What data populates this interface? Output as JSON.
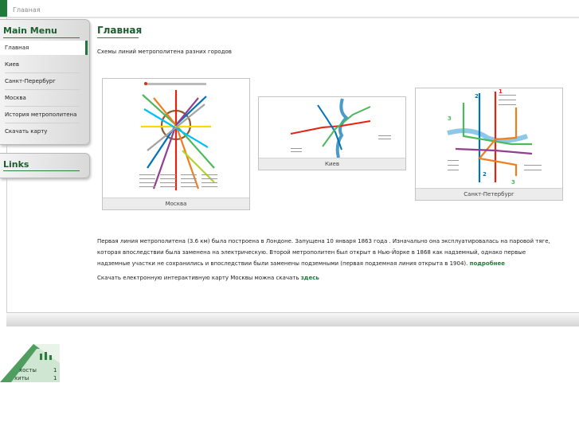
{
  "breadcrumb": "Главная",
  "sidebar": {
    "main_menu_title": "Main Menu",
    "items": [
      {
        "label": "Главная"
      },
      {
        "label": "Киев"
      },
      {
        "label": "Санкт-Перербург"
      },
      {
        "label": "Москва"
      },
      {
        "label": "История метрополитена"
      },
      {
        "label": "Скачать карту"
      }
    ],
    "links_title": "Links"
  },
  "main": {
    "title": "Главная",
    "subtitle": "Схемы линий метрополитена разних городов",
    "maps": [
      {
        "caption": "Москва"
      },
      {
        "caption": "Киев"
      },
      {
        "caption": "Санкт-Петербург"
      }
    ],
    "paragraph1_text": "Первая линия метрополитена  (3.6 км) была построена в Лондоне. Запущена 10 января 1863 года  . Изначально она эксплуатировалась на паровой тяге, которая впоследствии была заменена на электрическую. Второй метрополитен был открыт в Нью-Йорке в 1868 как надземный, однако первые надземные участки не сохранились и впоследствии были заменены подземными (первая подземная линия открыта в 1904).",
    "paragraph1_link": "подробнее",
    "paragraph2_text": "Скачать електронную интерактивную карту Москвы можна скачать",
    "paragraph2_link": "здесь"
  },
  "counter": {
    "rows": [
      {
        "label": "хосты",
        "value": "1"
      },
      {
        "label": "хиты",
        "value": "1"
      }
    ]
  },
  "colors": {
    "accent": "#1f7a3a",
    "title": "#1b5e2e"
  }
}
